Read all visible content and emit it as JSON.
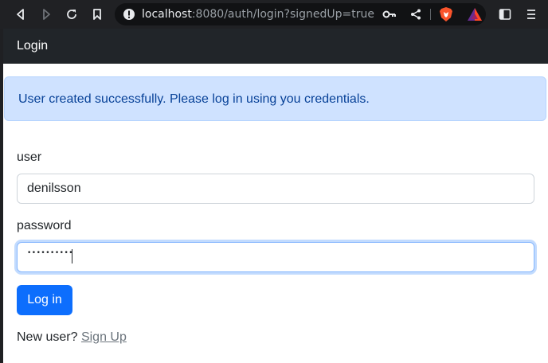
{
  "browser": {
    "url_host": "localhost",
    "url_rest": ":8080/auth/login?signedUp=true"
  },
  "app": {
    "title": "Login"
  },
  "alert": {
    "message": "User created successfully. Please log in using you credentials."
  },
  "form": {
    "user_label": "user",
    "user_value": "denilsson",
    "password_label": "password",
    "password_masked": "••••••••••",
    "submit_label": "Log in"
  },
  "footer": {
    "prompt": "New user?",
    "signup_link": "Sign Up"
  },
  "colors": {
    "navbar": "#212529",
    "alert_bg": "#cfe2ff",
    "alert_text": "#084298",
    "primary": "#0d6efd"
  }
}
